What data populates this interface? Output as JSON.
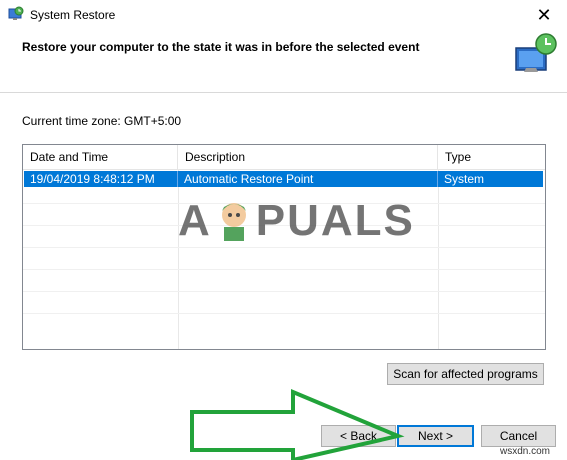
{
  "window": {
    "title": "System Restore",
    "close_glyph": "✕"
  },
  "header": {
    "text": "Restore your computer to the state it was in before the selected event",
    "icon": "system-restore-monitor-icon"
  },
  "timezone": {
    "label": "Current time zone: GMT+5:00"
  },
  "list": {
    "columns": [
      "Date and Time",
      "Description",
      "Type"
    ],
    "rows": [
      {
        "date": "19/04/2019 8:48:12 PM",
        "description": "Automatic Restore Point",
        "type": "System"
      }
    ]
  },
  "buttons": {
    "scan": "Scan for affected programs",
    "back": "< Back",
    "next": "Next >",
    "cancel": "Cancel"
  },
  "watermark": {
    "logo_a": "A",
    "logo_rest": "PUALS",
    "site": "wsxdn.com"
  },
  "colors": {
    "selection": "#0078d7",
    "arrow": "#22a33a"
  }
}
